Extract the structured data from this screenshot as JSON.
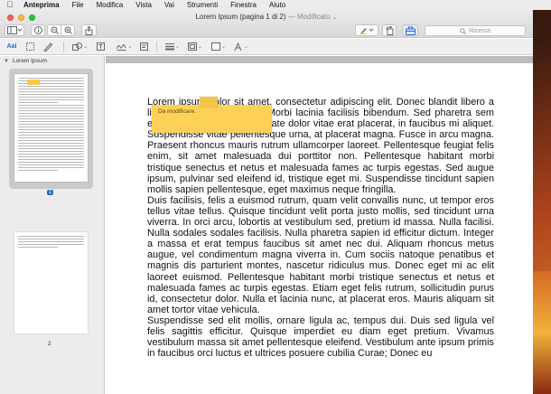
{
  "menubar": {
    "apple_icon": "apple-logo",
    "items": [
      "Anteprima",
      "File",
      "Modifica",
      "Vista",
      "Vai",
      "Strumenti",
      "Finestra",
      "Aiuto"
    ]
  },
  "window": {
    "title": "Lorem Ipsum (pagina 1 di 2)",
    "title_status": "— Modificato",
    "title_chevron": "⌄"
  },
  "toolbar": {
    "search_placeholder": "Ricerca",
    "search_icon": "magnifier-icon"
  },
  "sidebar": {
    "document_name": "Lorem Ipsum",
    "pages": [
      {
        "number": "1",
        "selected": true
      },
      {
        "number": "2",
        "selected": false
      }
    ]
  },
  "document": {
    "paragraphs": [
      "Lorem ipsum dolor sit amet, consectetur adipiscing elit. Donec blandit libero a ligula laoreet, eget cursus Morbi lacinia facilisis bibendum. Sed pharetra sem eget lectus iaculis, ac vulputate dolor vitae erat placerat, in faucibus mi aliquet. Suspendisse vitae pellentesque urna, at placerat magna. Fusce in arcu magna. Praesent rhoncus mauris rutrum ullamcorper laoreet. Pellentesque feugiat felis enim, sit amet malesuada dui porttitor non. Pellentesque habitant morbi tristique senectus et netus et malesuada fames ac turpis egestas. Sed augue ipsum, pulvinar sed eleifend id, tristique eget mi. Suspendisse tincidunt sapien mollis sapien pellentesque, eget maximus neque fringilla.",
      "Duis facilisis, felis a euismod rutrum, quam velit convallis nunc, ut tempor eros tellus vitae tellus. Quisque tincidunt velit porta justo mollis, sed tincidunt urna viverra. In orci arcu, lobortis at vestibulum sed, pretium id massa. Nulla facilisi. Nulla sodales sodales facilisis. Nulla pharetra sapien id efficitur dictum. Integer a massa et erat tempus faucibus sit amet nec dui. Aliquam rhoncus metus augue, vel condimentum magna viverra in. Cum sociis natoque penatibus et magnis dis parturient montes, nascetur ridiculus mus. Donec eget mi ac elit laoreet euismod. Pellentesque habitant morbi tristique senectus et netus et malesuada fames ac turpis egestas. Etiam eget felis rutrum, sollicitudin purus id, consectetur dolor. Nulla et lacinia nunc, at placerat eros. Mauris aliquam sit amet tortor vitae vehicula.",
      "Suspendisse sed elit mollis, ornare ligula ac, tempus dui. Duis sed ligula vel felis sagittis efficitur. Quisque imperdiet eu diam eget pretium. Vivamus vestibulum massa sit amet pellentesque eleifend. Vestibulum ante ipsum primis in faucibus orci luctus et ultrices posuere cubilia Curae; Donec eu"
    ],
    "note_text": "Da modificare."
  }
}
